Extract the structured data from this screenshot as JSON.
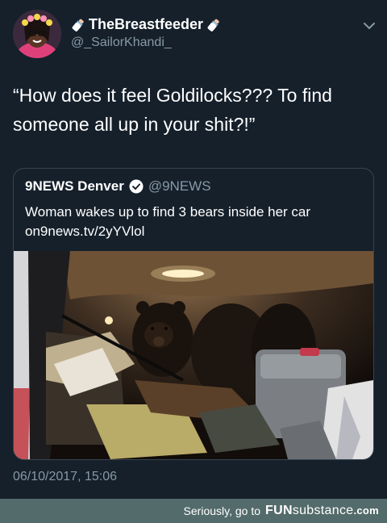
{
  "tweet": {
    "display_name": "TheBreastfeeder",
    "handle": "@_SailorKhandi_",
    "text": "“How does it feel Goldilocks??? To find someone all up in your shit?!”",
    "timestamp": "06/10/2017, 15:06",
    "icons": [
      "baby-bottle-icon",
      "chevron-down-icon",
      "verified-badge-icon"
    ]
  },
  "quote": {
    "name": "9NEWS Denver",
    "handle": "@9NEWS",
    "text": "Woman wakes up to find 3 bears inside her car",
    "link": "on9news.tv/2yYVlol"
  },
  "footer": {
    "text": "Seriously, go to",
    "logo_bold": "FUN",
    "logo_thin": "substance",
    "domain": ".com"
  },
  "colors": {
    "background": "#15202b",
    "secondary_text": "#8899a6",
    "border": "#38444d",
    "footer_bar": "#546b6b"
  }
}
